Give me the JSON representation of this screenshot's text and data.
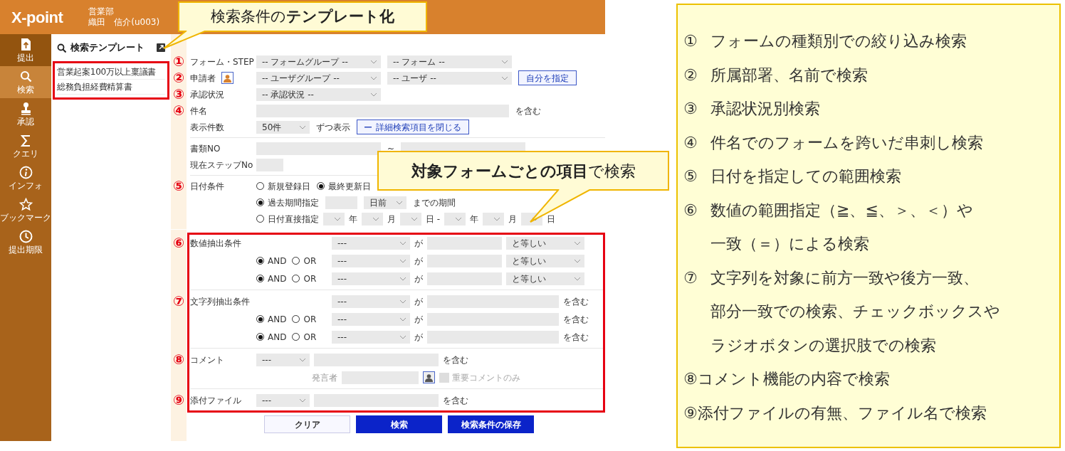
{
  "header": {
    "logo": "X-point",
    "department": "営業部",
    "user": "織田　信介(u003)"
  },
  "nav": [
    {
      "kind": "submit",
      "label": "提出",
      "selected": false
    },
    {
      "kind": "search",
      "label": "検索",
      "selected": true
    },
    {
      "kind": "approve",
      "label": "承認",
      "selected": false
    },
    {
      "kind": "query",
      "label": "クエリ",
      "selected": false
    },
    {
      "kind": "info",
      "label": "インフォ",
      "selected": false
    },
    {
      "kind": "bookmark",
      "label": "ブックマーク",
      "selected": false
    },
    {
      "kind": "deadline",
      "label": "提出期限",
      "selected": false
    }
  ],
  "template_panel": {
    "title": "検索テンプレート",
    "items": [
      "営業起案100万以上稟議書",
      "総務負担経費精算書"
    ]
  },
  "form": {
    "sections": [
      {
        "kind": "basic",
        "highlighted": false,
        "rows": [
          {
            "marker": "①",
            "label": "フォーム・STEP",
            "controls": [
              {
                "kind": "select",
                "value": "-- フォームグループ --"
              },
              {
                "kind": "select",
                "value": "-- フォーム --"
              }
            ]
          },
          {
            "marker": "②",
            "label": "申請者",
            "label_control": {
              "kind": "user-picker",
              "disabled": false
            },
            "controls": [
              {
                "kind": "select",
                "value": "-- ユーザグループ --"
              },
              {
                "kind": "select",
                "value": "-- ユーザ --"
              },
              {
                "kind": "button",
                "label": "自分を指定"
              }
            ]
          },
          {
            "marker": "③",
            "label": "承認状況",
            "controls": [
              {
                "kind": "select",
                "value": "-- 承認状況 --"
              }
            ]
          },
          {
            "marker": "④",
            "label": "件名",
            "controls": [
              {
                "kind": "field"
              },
              {
                "kind": "text",
                "text": "を含む",
                "muted": false
              }
            ]
          },
          {
            "label": "表示件数",
            "controls": [
              {
                "kind": "select",
                "value": "50件"
              },
              {
                "kind": "text",
                "text": "ずつ表示",
                "muted": false
              },
              {
                "kind": "toggle-button",
                "label": "詳細検索項目を閉じる"
              }
            ]
          }
        ]
      },
      {
        "kind": "basic",
        "highlighted": false,
        "rows": [
          {
            "label": "書類NO",
            "controls": [
              {
                "kind": "field"
              },
              {
                "kind": "text",
                "text": "~",
                "muted": false
              },
              {
                "kind": "field"
              }
            ]
          },
          {
            "label": "現在ステップNo",
            "controls": [
              {
                "kind": "field"
              }
            ]
          }
        ]
      },
      {
        "kind": "basic",
        "highlighted": false,
        "rows": [
          {
            "marker": "⑤",
            "label": "日付条件",
            "controls": [
              {
                "kind": "radio",
                "label": "新規登録日",
                "selected": false
              },
              {
                "kind": "radio",
                "label": "最終更新日",
                "selected": true
              }
            ]
          },
          {
            "controls": [
              {
                "kind": "radio",
                "label": "過去期間指定",
                "selected": true
              },
              {
                "kind": "field"
              },
              {
                "kind": "select",
                "value": "日前"
              },
              {
                "kind": "text",
                "text": "までの期間",
                "muted": false
              }
            ]
          },
          {
            "controls": [
              {
                "kind": "radio",
                "label": "日付直接指定",
                "selected": false
              },
              {
                "kind": "select"
              },
              {
                "kind": "text",
                "text": "年",
                "muted": false
              },
              {
                "kind": "select"
              },
              {
                "kind": "text",
                "text": "月",
                "muted": false
              },
              {
                "kind": "select"
              },
              {
                "kind": "text",
                "text": "日 -",
                "muted": false
              },
              {
                "kind": "select"
              },
              {
                "kind": "text",
                "text": "年",
                "muted": false
              },
              {
                "kind": "select"
              },
              {
                "kind": "text",
                "text": "月",
                "muted": false
              },
              {
                "kind": "select"
              },
              {
                "kind": "text",
                "text": "日",
                "muted": false
              }
            ]
          }
        ]
      },
      {
        "kind": "conditions",
        "highlighted": true,
        "rows": [
          {
            "marker": "⑥",
            "label": "数値抽出条件",
            "controls": [
              {
                "kind": "select",
                "value": "---"
              },
              {
                "kind": "text",
                "text": "が",
                "muted": false
              },
              {
                "kind": "field"
              },
              {
                "kind": "select",
                "value": "と等しい"
              }
            ]
          },
          {
            "conjunction": [
              {
                "label": "AND",
                "selected": true
              },
              {
                "label": "OR",
                "selected": false
              }
            ],
            "controls": [
              {
                "kind": "select",
                "value": "---"
              },
              {
                "kind": "text",
                "text": "が",
                "muted": false
              },
              {
                "kind": "field"
              },
              {
                "kind": "select",
                "value": "と等しい"
              }
            ]
          },
          {
            "conjunction": [
              {
                "label": "AND",
                "selected": true
              },
              {
                "label": "OR",
                "selected": false
              }
            ],
            "controls": [
              {
                "kind": "select",
                "value": "---"
              },
              {
                "kind": "text",
                "text": "が",
                "muted": false
              },
              {
                "kind": "field"
              },
              {
                "kind": "select",
                "value": "と等しい"
              }
            ]
          }
        ]
      },
      {
        "kind": "conditions",
        "highlighted": true,
        "rows": [
          {
            "marker": "⑦",
            "label": "文字列抽出条件",
            "controls": [
              {
                "kind": "select",
                "value": "---"
              },
              {
                "kind": "text",
                "text": "が",
                "muted": false
              },
              {
                "kind": "field"
              },
              {
                "kind": "text",
                "text": "を含む",
                "muted": false
              }
            ]
          },
          {
            "conjunction": [
              {
                "label": "AND",
                "selected": true
              },
              {
                "label": "OR",
                "selected": false
              }
            ],
            "controls": [
              {
                "kind": "select",
                "value": "---"
              },
              {
                "kind": "text",
                "text": "が",
                "muted": false
              },
              {
                "kind": "field"
              },
              {
                "kind": "text",
                "text": "を含む",
                "muted": false
              }
            ]
          },
          {
            "conjunction": [
              {
                "label": "AND",
                "selected": true
              },
              {
                "label": "OR",
                "selected": false
              }
            ],
            "controls": [
              {
                "kind": "select",
                "value": "---"
              },
              {
                "kind": "text",
                "text": "が",
                "muted": false
              },
              {
                "kind": "field"
              },
              {
                "kind": "text",
                "text": "を含む",
                "muted": false
              }
            ]
          }
        ]
      },
      {
        "kind": "basic",
        "highlighted": true,
        "rows": [
          {
            "marker": "⑧",
            "label": "コメント",
            "controls": [
              {
                "kind": "select",
                "value": "---"
              },
              {
                "kind": "field"
              },
              {
                "kind": "text",
                "text": "を含む",
                "muted": false
              }
            ]
          },
          {
            "controls": [
              {
                "kind": "text",
                "text": "発言者",
                "muted": true
              },
              {
                "kind": "field"
              },
              {
                "kind": "user-picker",
                "disabled": true
              },
              {
                "kind": "checkbox",
                "label": "重要コメントのみ",
                "checked": false,
                "disabled": true
              }
            ]
          }
        ]
      },
      {
        "kind": "basic",
        "highlighted": true,
        "rows": [
          {
            "marker": "⑨",
            "label": "添付ファイル",
            "controls": [
              {
                "kind": "select",
                "value": "---"
              },
              {
                "kind": "field"
              },
              {
                "kind": "text",
                "text": "を含む",
                "muted": false
              }
            ]
          }
        ]
      }
    ],
    "buttons": [
      {
        "label": "クリア",
        "primary": false
      },
      {
        "label": "検索",
        "primary": true
      },
      {
        "label": "検索条件の保存",
        "primary": true
      }
    ]
  },
  "callouts": [
    {
      "text": "検索条件の**テンプレート化**"
    },
    {
      "text": "**対象フォームごとの項目**で検索"
    }
  ],
  "notes": [
    {
      "marker": "①",
      "lines": [
        "フォームの種類別での絞り込み検索"
      ]
    },
    {
      "marker": "②",
      "lines": [
        "所属部署、名前で検索"
      ]
    },
    {
      "marker": "③",
      "lines": [
        "承認状況別検索"
      ]
    },
    {
      "marker": "④",
      "lines": [
        "件名でのフォームを跨いだ串刺し検索"
      ]
    },
    {
      "marker": "⑤",
      "lines": [
        "日付を指定しての範囲検索"
      ]
    },
    {
      "marker": "⑥",
      "lines": [
        "数値の範囲指定（≧、≦、＞、＜）や",
        "一致（＝）による検索"
      ]
    },
    {
      "marker": "⑦",
      "lines": [
        "文字列を対象に前方一致や後方一致、",
        "部分一致での検索、チェックボックスや",
        "ラジオボタンの選択肢での検索"
      ]
    },
    {
      "lines": [
        "⑧コメント機能の内容で検索"
      ]
    },
    {
      "lines": [
        "⑨添付ファイルの有無、ファイル名で検索"
      ]
    }
  ]
}
